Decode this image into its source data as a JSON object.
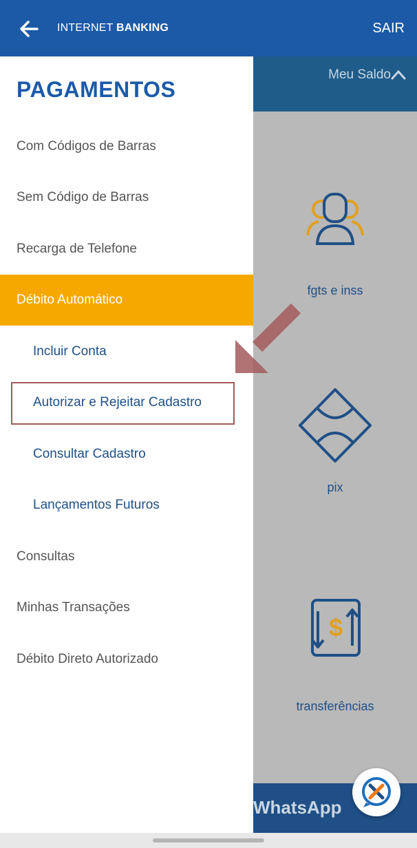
{
  "header": {
    "brand_part1": "INTERNET ",
    "brand_part2": "BANKING",
    "logout_label": "SAIR"
  },
  "balance": {
    "label": "Meu Saldo"
  },
  "services": [
    {
      "label": "fgts e inss",
      "icon": "people-icon"
    },
    {
      "label": "pix",
      "icon": "pix-icon"
    },
    {
      "label": "transferências",
      "icon": "transfer-icon"
    }
  ],
  "whatsapp_banner": {
    "label": "WhatsApp"
  },
  "drawer": {
    "title": "PAGAMENTOS",
    "items": [
      {
        "label": "Com Códigos de Barras"
      },
      {
        "label": "Sem Código de Barras"
      },
      {
        "label": "Recarga de Telefone"
      },
      {
        "label": "Débito Automático"
      },
      {
        "label": "Incluir Conta"
      },
      {
        "label": "Autorizar e Rejeitar Cadastro"
      },
      {
        "label": "Consultar Cadastro"
      },
      {
        "label": "Lançamentos Futuros"
      },
      {
        "label": "Consultas"
      },
      {
        "label": "Minhas Transações"
      },
      {
        "label": "Débito Direto Autorizado"
      }
    ]
  },
  "colors": {
    "primary": "#1c5aa8",
    "accent": "#f6a800",
    "highlight": "#a35a5a"
  }
}
